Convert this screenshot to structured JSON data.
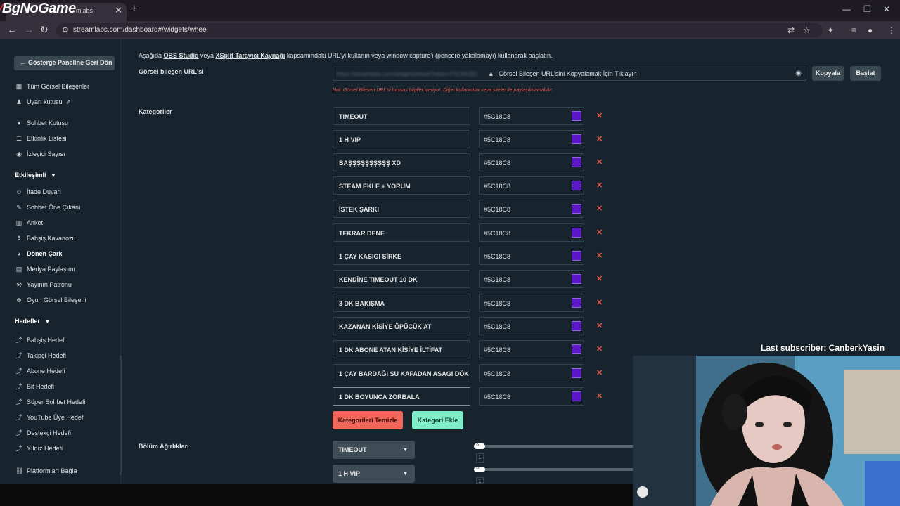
{
  "browser": {
    "logo": "BgNoGame",
    "tab_title": "mlabs",
    "tab_close": "✕",
    "new_tab": "+",
    "url": "streamlabs.com/dashboard#/widgets/wheel",
    "window_controls": {
      "minimize": "—",
      "restore": "❐",
      "close": "✕"
    }
  },
  "sidebar": {
    "back_label": "Gösterge Paneline Geri Dön",
    "items_top": [
      {
        "label": "Tüm Görsel Bileşenler",
        "icon": "grid-icon"
      },
      {
        "label": "Uyarı kutusu",
        "icon": "bell-icon"
      },
      {
        "label": "Sohbet Kutusu",
        "icon": "chat-icon"
      },
      {
        "label": "Etkinlik Listesi",
        "icon": "list-icon"
      },
      {
        "label": "İzleyici Sayısı",
        "icon": "eye-icon"
      }
    ],
    "section_interaction": "Etkileşimli",
    "items_interaction": [
      {
        "label": "İfade Duvarı",
        "icon": "smile-icon"
      },
      {
        "label": "Sohbet Öne Çıkanı",
        "icon": "pin-icon"
      },
      {
        "label": "Anket",
        "icon": "poll-icon"
      },
      {
        "label": "Bahşiş Kavanozu",
        "icon": "jar-icon"
      },
      {
        "label": "Dönen Çark",
        "icon": "wheel-icon"
      },
      {
        "label": "Medya Paylaşımı",
        "icon": "media-icon"
      },
      {
        "label": "Yayının Patronu",
        "icon": "hammer-icon"
      },
      {
        "label": "Oyun Görsel Bileşeni",
        "icon": "gamepad-icon"
      }
    ],
    "section_goals": "Hedefler",
    "items_goals": [
      {
        "label": "Bahşiş Hedefi",
        "icon": "goal-icon"
      },
      {
        "label": "Takipçi Hedefi",
        "icon": "goal-icon"
      },
      {
        "label": "Abone Hedefi",
        "icon": "goal-icon"
      },
      {
        "label": "Bit Hedefi",
        "icon": "goal-icon"
      },
      {
        "label": "Süper Sohbet Hedefi",
        "icon": "goal-icon"
      },
      {
        "label": "YouTube Üye Hedefi",
        "icon": "goal-icon"
      },
      {
        "label": "Destekçi Hedefi",
        "icon": "goal-icon"
      },
      {
        "label": "Yıldız Hedefi",
        "icon": "goal-icon"
      }
    ],
    "platform_link": "Platformları Bağla"
  },
  "main": {
    "intro": {
      "p1": "Aşağıda ",
      "obs": "OBS Studio",
      "p2": " veya ",
      "xsplit": "XSplit Tarayıcı Kaynağı",
      "p3": " kapsamındaki URL'yi kullanın veya window capture'ı (pencere yakalamayı) kullanarak başlatın."
    },
    "url_label": "Görsel bileşen URL'si",
    "url_masked": "https://streamlabs.com/widgets/wheel?token=F5C8A2B1",
    "url_cta": "Görsel Bileşen URL'sini Kopyalamak İçin Tıklayın",
    "copy_button": "Kopyala",
    "launch_button": "Başlat",
    "note": "Not: Görsel Bileşen URL'si hassas bilgiler içeriyor. Diğer kullanıcılar veya siteler ile paylaşılmamalıdır.",
    "categories_label": "Kategoriler",
    "categories": [
      {
        "name": "TIMEOUT",
        "color": "#5C18C8"
      },
      {
        "name": "1 H VIP",
        "color": "#5C18C8"
      },
      {
        "name": "BAŞŞŞŞŞŞŞŞŞŞ XD",
        "color": "#5C18C8"
      },
      {
        "name": "STEAM EKLE + YORUM",
        "color": "#5C18C8"
      },
      {
        "name": "İSTEK ŞARKI",
        "color": "#5C18C8"
      },
      {
        "name": "TEKRAR DENE",
        "color": "#5C18C8"
      },
      {
        "name": "1 ÇAY KASIGI SİRKE",
        "color": "#5C18C8"
      },
      {
        "name": "KENDİNE TIMEOUT 10 DK",
        "color": "#5C18C8"
      },
      {
        "name": "3 DK BAKIŞMA",
        "color": "#5C18C8"
      },
      {
        "name": "KAZANAN KİSİYE ÖPÜCÜK AT",
        "color": "#5C18C8"
      },
      {
        "name": "1 DK ABONE ATAN KİSİYE İLTİFAT",
        "color": "#5C18C8"
      },
      {
        "name": "1 ÇAY BARDAĞI SU KAFADAN ASAGI DÖK",
        "color": "#5C18C8"
      },
      {
        "name": "1 DK BOYUNCA ZORBALA",
        "color": "#5C18C8"
      }
    ],
    "delete_glyph": "✕",
    "clear_button": "Kategorileri Temizle",
    "add_button": "Kategori Ekle",
    "weights_label": "Bölüm Ağırlıkları",
    "weights": [
      {
        "category": "TIMEOUT",
        "value": "1"
      },
      {
        "category": "1 H VIP",
        "value": "1"
      }
    ]
  },
  "overlay": {
    "caption": "Last subscriber: CanberkYasin"
  }
}
